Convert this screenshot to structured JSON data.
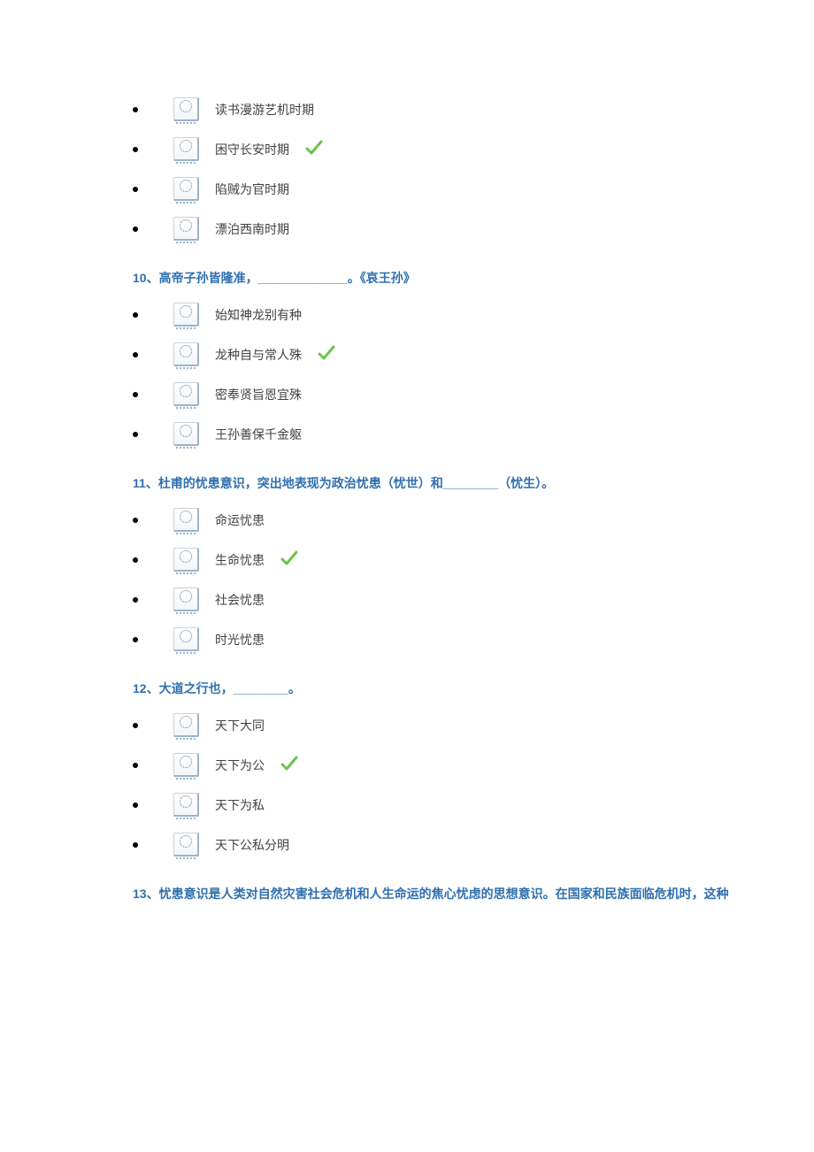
{
  "block_pre": {
    "options": [
      {
        "text": "读书漫游艺机时期",
        "correct": false
      },
      {
        "text": "困守长安时期",
        "correct": true
      },
      {
        "text": "陷贼为官时期",
        "correct": false
      },
      {
        "text": "漂泊西南时期",
        "correct": false
      }
    ]
  },
  "q10": {
    "title": "10、高帝子孙皆隆准，_____________。《哀王孙》",
    "options": [
      {
        "text": "始知神龙别有种",
        "correct": false
      },
      {
        "text": "龙种自与常人殊",
        "correct": true
      },
      {
        "text": "密奉贤旨恩宜殊",
        "correct": false
      },
      {
        "text": "王孙善保千金躯",
        "correct": false
      }
    ]
  },
  "q11": {
    "title": "11、杜甫的忧患意识，突出地表现为政治忧患（忧世）和________（忧生）。",
    "options": [
      {
        "text": "命运忧患",
        "correct": false
      },
      {
        "text": "生命忧患",
        "correct": true
      },
      {
        "text": "社会忧患",
        "correct": false
      },
      {
        "text": "时光忧患",
        "correct": false
      }
    ]
  },
  "q12": {
    "title": "12、大道之行也，________。",
    "options": [
      {
        "text": "天下大同",
        "correct": false
      },
      {
        "text": "天下为公",
        "correct": true
      },
      {
        "text": "天下为私",
        "correct": false
      },
      {
        "text": "天下公私分明",
        "correct": false
      }
    ]
  },
  "q13": {
    "title": "13、忧患意识是人类对自然灾害社会危机和人生命运的焦心忧虑的思想意识。在国家和民族面临危机时，这种"
  }
}
